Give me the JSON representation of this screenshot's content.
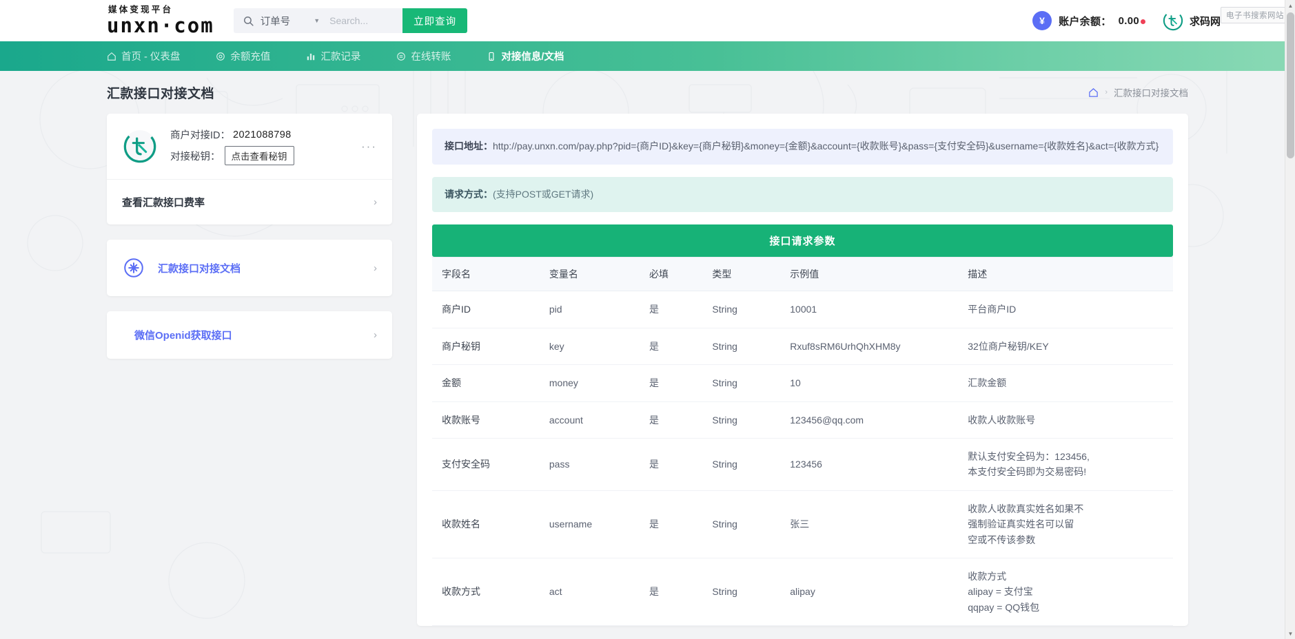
{
  "header": {
    "brand_sub": "媒体变现平台",
    "brand_main": "unxn·com",
    "search": {
      "icon": "search-icon",
      "selected_type": "订单号",
      "caret": "▼",
      "placeholder": "Search...",
      "value": "",
      "button_label": "立即查询"
    },
    "balance": {
      "currency_icon": "¥",
      "label": "账户余额：",
      "value": "0.00"
    },
    "site": {
      "logo_icon": "site-logo-icon",
      "name": "求码网"
    },
    "tooltip": "电子书搜索网站"
  },
  "nav": {
    "items": [
      {
        "icon": "home-icon",
        "label": "首页 - 仪表盘",
        "active": false
      },
      {
        "icon": "wallet-icon",
        "label": "余额充值",
        "active": false
      },
      {
        "icon": "chart-icon",
        "label": "汇款记录",
        "active": false
      },
      {
        "icon": "transfer-icon",
        "label": "在线转账",
        "active": false
      },
      {
        "icon": "doc-icon",
        "label": "对接信息/文档",
        "active": true
      }
    ]
  },
  "page": {
    "title": "汇款接口对接文档",
    "breadcrumb": {
      "home_icon": "home-icon",
      "separator": "›",
      "current": "汇款接口对接文档"
    }
  },
  "sidebar": {
    "merchant": {
      "logo_icon": "merchant-logo-icon",
      "id_label": "商户对接ID：",
      "id_value": "2021088798",
      "key_label": "对接秘钥：",
      "key_button": "点击查看秘钥",
      "more_icon": "ellipsis-icon"
    },
    "rate_row": {
      "label": "查看汇款接口费率",
      "chevron": "›"
    },
    "links": [
      {
        "icon": "hash-badge-icon",
        "label": "汇款接口对接文档",
        "chevron": "›",
        "has_icon": true
      },
      {
        "icon": "",
        "label": "微信Openid获取接口",
        "chevron": "›",
        "has_icon": false
      }
    ]
  },
  "main": {
    "api_url_box": {
      "label": "接口地址：",
      "url": "http://pay.unxn.com/pay.php?pid={商户ID}&key={商户秘钥}&money={金额}&account={收款账号}&pass={支付安全码}&username={收款姓名}&act={收款方式}"
    },
    "method_box": {
      "label": "请求方式：",
      "value": "(支持POST或GET请求)"
    },
    "section_title": "接口请求参数",
    "table": {
      "columns": [
        "字段名",
        "变量名",
        "必填",
        "类型",
        "示例值",
        "描述"
      ],
      "rows": [
        {
          "field": "商户ID",
          "variable": "pid",
          "required": "是",
          "type": "String",
          "example": "10001",
          "description": "平台商户ID"
        },
        {
          "field": "商户秘钥",
          "variable": "key",
          "required": "是",
          "type": "String",
          "example": "Rxuf8sRM6UrhQhXHM8y",
          "description": "32位商户秘钥/KEY"
        },
        {
          "field": "金额",
          "variable": "money",
          "required": "是",
          "type": "String",
          "example": "10",
          "description": "汇款金额"
        },
        {
          "field": "收款账号",
          "variable": "account",
          "required": "是",
          "type": "String",
          "example": "123456@qq.com",
          "description": "收款人收款账号"
        },
        {
          "field": "支付安全码",
          "variable": "pass",
          "required": "是",
          "type": "String",
          "example": "123456",
          "description": "默认支付安全码为：123456,\n本支付安全码即为交易密码!"
        },
        {
          "field": "收款姓名",
          "variable": "username",
          "required": "是",
          "type": "String",
          "example": "张三",
          "description": "收款人收款真实姓名如果不\n强制验证真实姓名可以留\n空或不传该参数"
        },
        {
          "field": "收款方式",
          "variable": "act",
          "required": "是",
          "type": "String",
          "example": "alipay",
          "description": "收款方式\nalipay = 支付宝\nqqpay = QQ钱包"
        }
      ]
    }
  },
  "scrollbar": {
    "up_arrow": "▲",
    "down_arrow": "▼"
  },
  "colors": {
    "nav_start": "#1aa88c",
    "nav_end": "#8ad9b5",
    "accent_green": "#17b277",
    "accent_blue": "#5b6ef5",
    "alert_blue_bg": "#eef1fd",
    "alert_teal_bg": "#dff3ef"
  }
}
